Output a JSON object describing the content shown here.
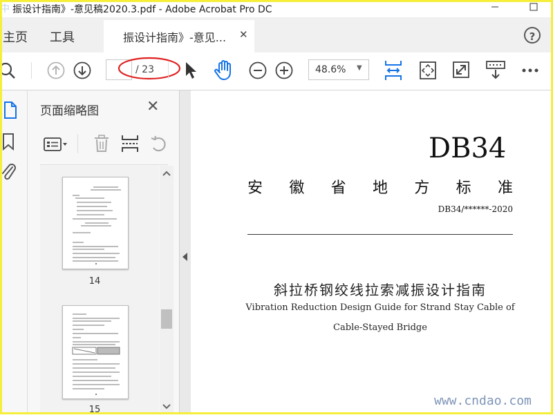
{
  "window": {
    "title": "振设计指南》-意见稿2020.3.pdf - Adobe Acrobat Pro DC",
    "logo_text": "中"
  },
  "tabs": {
    "home": "主页",
    "tools": "工具",
    "document": "振设计指南》-意见..."
  },
  "toolbar": {
    "page_current": "",
    "page_total": "/ 23",
    "zoom": "48.6%"
  },
  "panel": {
    "title": "页面缩略图",
    "thumbnails": [
      {
        "label": "14"
      },
      {
        "label": "15"
      }
    ]
  },
  "document": {
    "code_big": "DB34",
    "standard_chars": [
      "安",
      "徽",
      "省",
      "地",
      "方",
      "标",
      "准"
    ],
    "code_small": "DB34/******-2020",
    "title_cn": "斜拉桥钢绞线拉索减振设计指南",
    "title_en_line1": "Vibration Reduction Design Guide for Strand Stay Cable of",
    "title_en_line2": "Cable-Stayed Bridge"
  },
  "watermark": "www.cndao.com",
  "colors": {
    "accent_blue": "#1473e6",
    "annotation_red": "#e02020",
    "frame_yellow": "#f5ef3a"
  }
}
